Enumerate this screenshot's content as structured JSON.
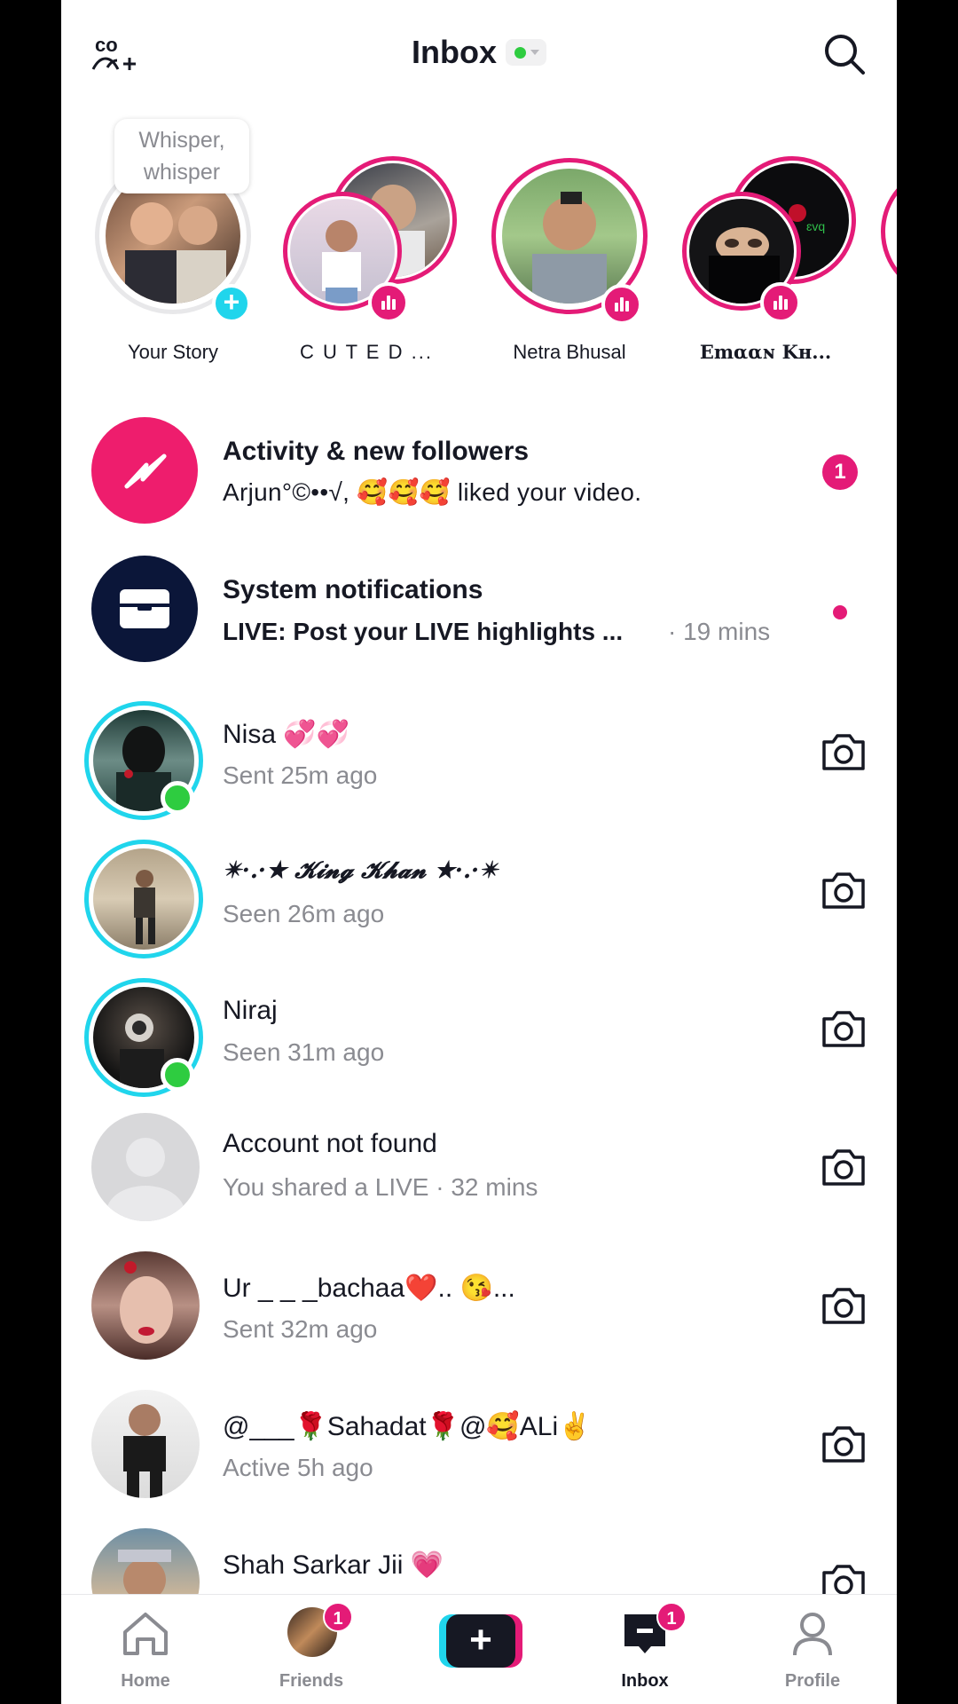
{
  "header": {
    "title": "Inbox",
    "status_color": "#2ecc40",
    "add_friends_icon": "add-friends-icon",
    "search_icon": "search-icon"
  },
  "stories": [
    {
      "name": "Your Story",
      "bubble_line1": "Whisper,",
      "bubble_line2": "whisper",
      "badge": "plus"
    },
    {
      "name": "C U T E   D ...",
      "badge": "live"
    },
    {
      "name": "Netra Bhusal",
      "badge": "live"
    },
    {
      "name": "Emααɴ Kʜ...",
      "badge": "live"
    }
  ],
  "system_rows": [
    {
      "title": "Activity & new followers",
      "subtitle": "Arjun°©••√, 🥰🥰🥰 liked your video.",
      "badge_count": "1",
      "icon": "lightning-icon"
    },
    {
      "title": "System notifications",
      "subtitle": "LIVE: Post your LIVE highlights ...",
      "time": "· 19 mins",
      "icon": "inbox-tray-icon"
    }
  ],
  "conversations": [
    {
      "name": "Nisa 💞💞",
      "status": "Sent 25m ago"
    },
    {
      "name": "✴·.·★ 𝓚𝓲𝓷𝓰 𝓚𝓱𝓪𝓷 ★·.·✴",
      "status": "Seen 26m ago"
    },
    {
      "name": "Niraj",
      "status": "Seen 31m ago"
    },
    {
      "name": "Account not found",
      "status": "You shared a LIVE · 32 mins"
    },
    {
      "name": "Ur _ _ _bachaa❤️.. 😘...",
      "status": "Sent 32m ago"
    },
    {
      "name": "@___🌹Sahadat🌹@🥰ALi✌️",
      "status": "Active 5h ago"
    },
    {
      "name": "Shah Sarkar Jii 💗",
      "status": ""
    }
  ],
  "nav": {
    "home": "Home",
    "friends": "Friends",
    "friends_badge": "1",
    "inbox": "Inbox",
    "inbox_badge": "1",
    "profile": "Profile"
  },
  "colors": {
    "accent_pink": "#e41b77",
    "accent_cyan": "#20d5ec",
    "online_green": "#2ecc40"
  }
}
